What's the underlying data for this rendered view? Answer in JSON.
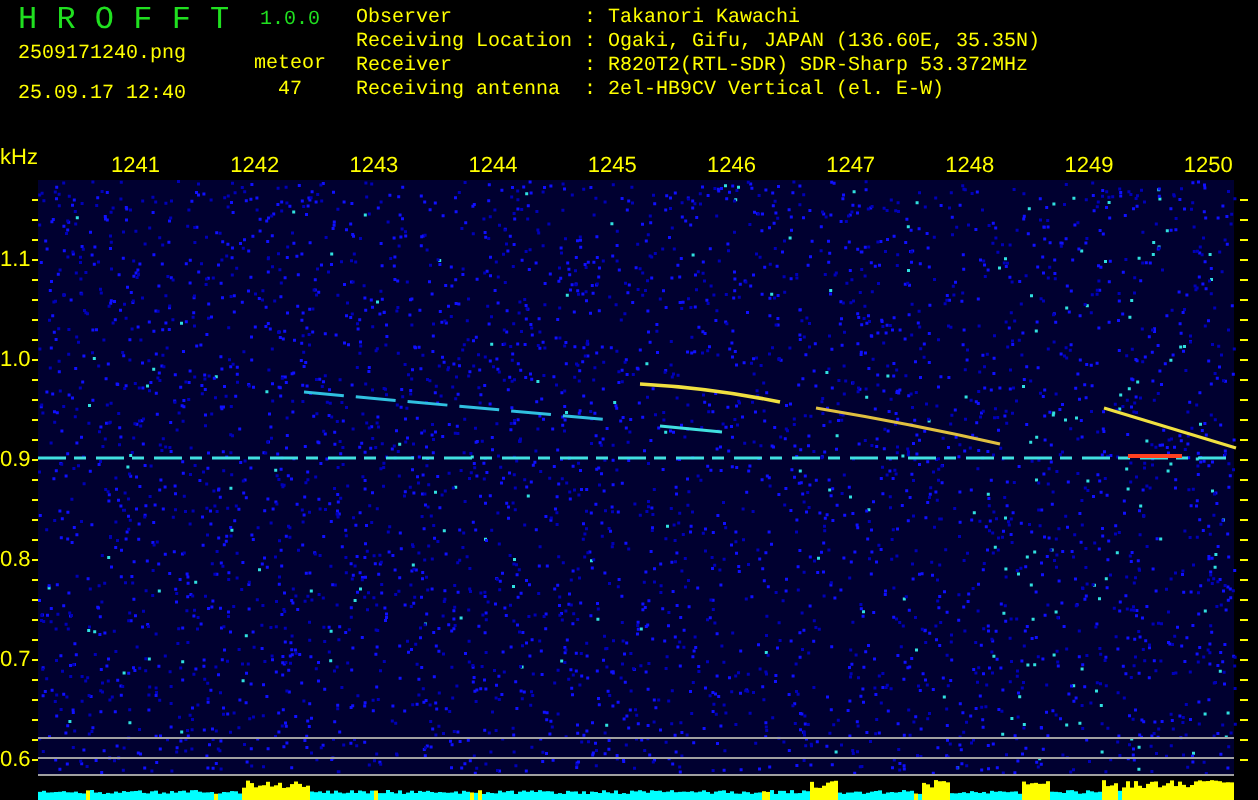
{
  "app": {
    "name": "H R O F F T",
    "version": "1.0.0"
  },
  "file": {
    "name": "2509171240.png",
    "timestamp": "25.09.17 12:40"
  },
  "meteor": {
    "label": "meteor",
    "count": "47"
  },
  "station": [
    {
      "label": "Observer",
      "separator": ":",
      "value": "Takanori Kawachi"
    },
    {
      "label": "Receiving Location",
      "separator": ":",
      "value": "Ogaki, Gifu, JAPAN (136.60E, 35.35N)"
    },
    {
      "label": "Receiver",
      "separator": ":",
      "value": "R820T2(RTL-SDR) SDR-Sharp 53.372MHz"
    },
    {
      "label": "Receiving antenna",
      "separator": ":",
      "value": "2el-HB9CV Vertical (el. E-W)"
    }
  ],
  "spectrogram": {
    "unit": "kHz",
    "time_labels": [
      "1241",
      "1242",
      "1243",
      "1244",
      "1245",
      "1246",
      "1247",
      "1248",
      "1249",
      "1250"
    ],
    "frequency_labels": [
      "1.1",
      "1.0",
      "0.9",
      "0.8",
      "0.7",
      "0.6"
    ]
  }
}
